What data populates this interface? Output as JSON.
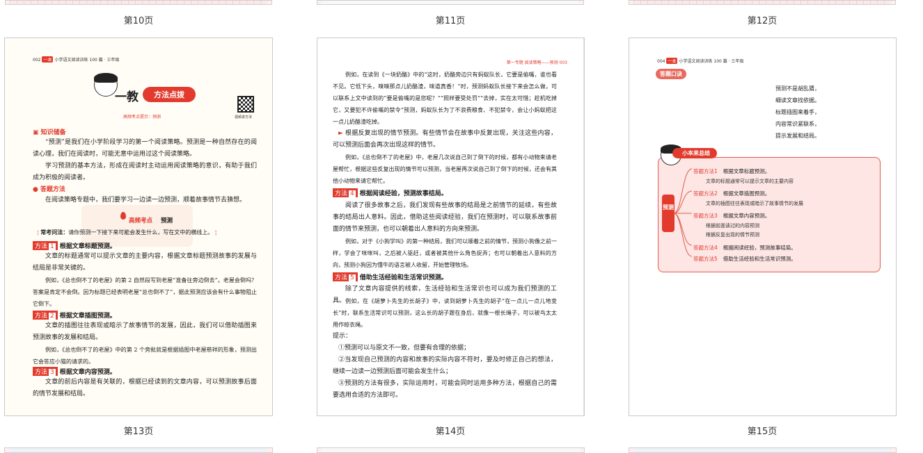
{
  "pages": {
    "p10": {
      "label": "第10页"
    },
    "p11": {
      "label": "第11页"
    },
    "p12": {
      "label": "第12页"
    },
    "p13": {
      "label": "第13页",
      "running_head": "002",
      "brand": "一本",
      "book_title": "小学语文阅读训练 100 篇 · 三年级",
      "jiao": "一教",
      "title": "方法点拨",
      "hint": "高频考点提示：预测",
      "qr_caption": "视频讲方法",
      "sec1": "知识储备",
      "p1": "“预测”是我们在小学阶段学习的第一个阅读策略。预测是一种自然存在的阅读心理，我们在阅读时，可能无意中运用过这个阅读策略。",
      "p2": "学习预测的基本方法，形成在阅读时主动运用阅读策略的意识，有助于我们成为积极的阅读者。",
      "sec2": "答题方法",
      "p3": "在阅读策略专题中，我们要学习一边读一边预测，顺着故事情节去猜想。",
      "hf_label": "高频考点",
      "hf_topic": "预测",
      "ask_label": "常考问法：",
      "ask_text": "请你预测一下接下来可能会发生什么，写在文中的横线上。",
      "m1_label": "方法",
      "m1_num": "1",
      "m1_text": "根据文章标题预测。",
      "m1_p": "文章的标题通常可以提示文章的主要内容，根据文章标题预测故事的发展与结局是非常关键的。",
      "m1_ex": "例如，《总也倒不了的老屋》的第 2 自然段写到老屋“准备往旁边倒去”。老屋会倒吗？答案是肯定不会倒。因为标题已经表明老屋“总也倒不了”，据此预测应该会有什么事物阻止它倒下。",
      "m2_label": "方法",
      "m2_num": "2",
      "m2_text": "根据文章插图预测。",
      "m2_p": "文章的插图往往表现或暗示了故事情节的发展，因此，我们可以借助插图来预测故事的发展和结局。",
      "m2_ex": "例如，《总也倒不了的老屋》中的第 2 个旁批就是根据插图中老屋慈祥的形象，预测出它会答应小猫的请求的。",
      "m3_label": "方法",
      "m3_num": "3",
      "m3_text": "根据文章内容预测。",
      "m3_p": "文章的前后内容是有关联的，根据已经读到的文章内容，可以预测故事后面的情节发展和结局。"
    },
    "p14": {
      "label": "第14页",
      "running_head": "第一专题  阅读策略——预测  003",
      "ex1": "例如，在读到《一块奶酪》中的“这时，奶酪旁边只有蚂蚁队长，它要是偷嘴，谁也看不见。它低下头，嗅嗅那点儿奶酪渣，味道真香！”时，预测蚂蚁队长接下来会怎么做，可以联系上文中读到的“要是偷嘴的是您呢？”“照样要受处罚”“去掉，实在太可惜；趁机吃掉它，又要犯不许偷嘴的禁令”预测，蚂蚁队长为了不浪费粮食、不犯禁令，会让小蚂蚁把这一点儿奶酪渣吃掉。",
      "pt": "根据反复出现的情节预测。有些情节会在故事中反复出现，关注这些内容，可以预测后面会再次出现这样的情节。",
      "ex2": "例如，《总也倒不了的老屋》中，老屋几次说自己到了倒下的时候，都有小动物来请老屋帮忙，根据这些反复出现的情节可以预测，当老屋再次说自己到了倒下的时候，还会有其他小动物来请它帮忙。",
      "m4_label": "方法",
      "m4_num": "4",
      "m4_text": "根据阅读经验，预测故事结局。",
      "m4_p": "阅读了很多故事之后，我们发现有些故事的结局是之前情节的延续，有些故事的结局出人意料。因此，借助这些阅读经验，我们在预测时，可以联系故事前面的情节来预测，也可以朝着出人意料的方向来预测。",
      "ex3": "例如，对于《小狗学叫》的第一种结局，我们可以顺着之前的情节，预测小狗像之前一样，学会了咪咪叫，之后被人驱赶，或者被其他什么角色捉弄；也可以朝着出人意料的方向，预测小狗因为懂牛的语言被人收留，开始管理牧场。",
      "m5_label": "方法",
      "m5_num": "5",
      "m5_text": "借助生活经验和生活常识预测。",
      "m5_p": "除了文章内容提供的线索，生活经验和生活常识也可以成为我们预测的工具。",
      "ex4": "例如，在《胡萝卜先生的长胡子》中，读到胡萝卜先生的胡子“在一点儿一点儿地变长”时，联系生活常识可以预测，这么长的胡子跟在身后，就像一根长绳子，可以被鸟太太用作晾衣绳。",
      "tips_label": "提示：",
      "tip1": "①预测可以与原文不一致，但要有合理的依据；",
      "tip2": "②当发现自己预测的内容和故事的实际内容不符时，要及时修正自己的想法，继续一边读一边预测后面可能会发生什么；",
      "tip3": "③预测的方法有很多，实际运用时，可能会同时运用多种方法，根据自己的需要选用合适的方法即可。"
    },
    "p15": {
      "label": "第15页",
      "running_head": "004",
      "brand": "一本",
      "book_title": "小学语文阅读训练 100 篇 · 三年级",
      "section": "答题口诀",
      "poem": [
        "预测不是胡乱猜，",
        "细读文章找依据。",
        "标题插图来着手，",
        "内容常识紧联系，",
        "提示发展和结局。"
      ],
      "summary_title": "小本来总结",
      "center": "预测",
      "methods": [
        {
          "label": "答题方法1",
          "title": "根据文章标题预测。",
          "subs": [
            "文章的标题通常可以提示文章的主要内容"
          ]
        },
        {
          "label": "答题方法2",
          "title": "根据文章插图预测。",
          "subs": [
            "文章的插图往往表现或暗示了故事情节的发展"
          ]
        },
        {
          "label": "答题方法3",
          "title": "根据文章内容预测。",
          "subs": [
            "根据前面读过的内容预测",
            "根据反复出现的情节预测"
          ]
        },
        {
          "label": "答题方法4",
          "title": "根据阅读经验，预测故事结局。",
          "subs": []
        },
        {
          "label": "答题方法5",
          "title": "借助生活经验和生活常识预测。",
          "subs": []
        }
      ]
    }
  },
  "colors": {
    "accent": "#e23b2e",
    "mindmap_bg": "#fde6e4"
  }
}
